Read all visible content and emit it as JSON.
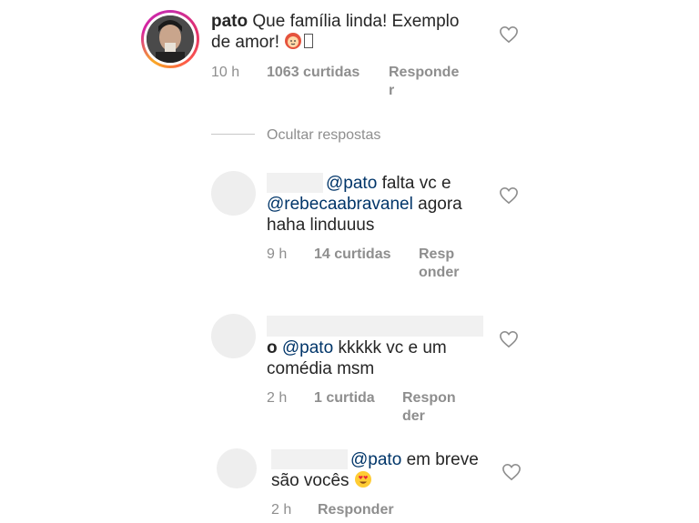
{
  "main_comment": {
    "username": "pato",
    "text_line1": "Que família linda! Exemplo",
    "text_line2": "de amor!",
    "time": "10 h",
    "likes": "1063 curtidas",
    "reply_label_line1": "Responde",
    "reply_label_line2": "r"
  },
  "toggle_replies_label": "Ocultar respostas",
  "replies": [
    {
      "mention": "@pato",
      "text_after_mention": "falta vc e",
      "mention2": "@rebecaabravanel",
      "text_after_mention2": "agora",
      "text_line3": "haha linduuus",
      "time": "9 h",
      "likes": "14 curtidas",
      "reply_label_line1": "Resp",
      "reply_label_line2": "onder"
    },
    {
      "prefix": "o",
      "mention": "@pato",
      "text_after_mention": "kkkkk vc e um",
      "text_line2": "comédia msm",
      "time": "2 h",
      "likes": "1 curtida",
      "reply_label_line1": "Respon",
      "reply_label_line2": "der"
    },
    {
      "mention": "@pato",
      "text_after_mention": "em breve",
      "text_line2": "são vocês",
      "time": "2 h",
      "reply_label": "Responder"
    }
  ],
  "icons": {
    "like": "heart-outline-icon",
    "emoji_main": "person-red-hair-emoji",
    "emoji_reply3": "heart-eyes-emoji"
  }
}
